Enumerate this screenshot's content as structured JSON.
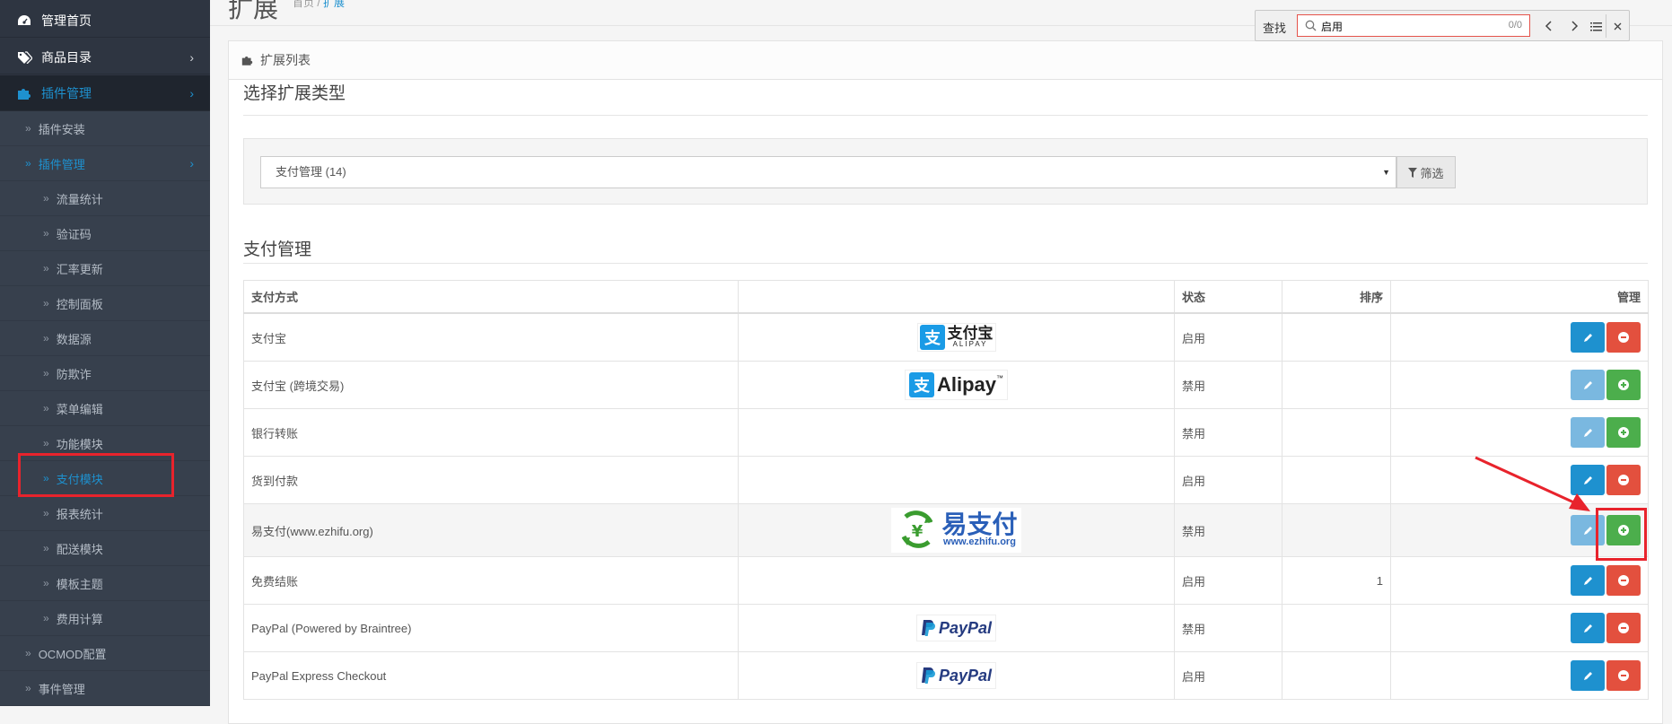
{
  "sidebar": {
    "items": [
      {
        "label": "管理首页",
        "icon": "dashboard-icon"
      },
      {
        "label": "商品目录",
        "icon": "tags-icon"
      },
      {
        "label": "插件管理",
        "icon": "puzzle-icon"
      }
    ],
    "sub_items": [
      {
        "label": "插件安装"
      },
      {
        "label": "插件管理"
      }
    ],
    "sub2_items": [
      {
        "label": "流量统计"
      },
      {
        "label": "验证码"
      },
      {
        "label": "汇率更新"
      },
      {
        "label": "控制面板"
      },
      {
        "label": "数据源"
      },
      {
        "label": "防欺诈"
      },
      {
        "label": "菜单编辑"
      },
      {
        "label": "功能模块"
      },
      {
        "label": "支付模块"
      },
      {
        "label": "报表统计"
      },
      {
        "label": "配送模块"
      },
      {
        "label": "模板主题"
      },
      {
        "label": "费用计算"
      }
    ],
    "bottom_items": [
      {
        "label": "OCMOD配置"
      },
      {
        "label": "事件管理"
      }
    ]
  },
  "header": {
    "title": "扩展",
    "breadcrumb_home": "首页",
    "breadcrumb_sep": " / ",
    "breadcrumb_current": "扩展"
  },
  "panel": {
    "heading": "扩展列表",
    "select_type_title": "选择扩展类型",
    "selected_type": "支付管理 (14)",
    "filter_label": "筛选",
    "section_title": "支付管理"
  },
  "table": {
    "headers": [
      "支付方式",
      "",
      "状态",
      "排序",
      "管理"
    ],
    "rows": [
      {
        "name": "支付宝",
        "logo": "alipay-cn",
        "status": "启用",
        "sort": "",
        "installed": true
      },
      {
        "name": "支付宝 (跨境交易)",
        "logo": "alipay-en",
        "status": "禁用",
        "sort": "",
        "installed": false
      },
      {
        "name": "银行转账",
        "logo": "",
        "status": "禁用",
        "sort": "",
        "installed": false
      },
      {
        "name": "货到付款",
        "logo": "",
        "status": "启用",
        "sort": "",
        "installed": true
      },
      {
        "name": "易支付(www.ezhifu.org)",
        "logo": "ezhifu",
        "status": "禁用",
        "sort": "",
        "installed": false
      },
      {
        "name": "免费结账",
        "logo": "",
        "status": "启用",
        "sort": "1",
        "installed": true
      },
      {
        "name": "PayPal (Powered by Braintree)",
        "logo": "paypal",
        "status": "禁用",
        "sort": "",
        "installed": true
      },
      {
        "name": "PayPal Express Checkout",
        "logo": "paypal",
        "status": "启用",
        "sort": "",
        "installed": true
      }
    ]
  },
  "logos": {
    "alipay_cn_text": "支付宝",
    "alipay_cn_sub": "ALIPAY",
    "alipay_en_text": "Alipay",
    "alipay_en_tm": "™",
    "ezhifu_text": "易支付",
    "ezhifu_url": "www.ezhifu.org",
    "paypal_text": "PayPal"
  },
  "find_bar": {
    "label": "查找",
    "query": "启用",
    "count": "0/0"
  },
  "colors": {
    "sidebar_bg": "#2e3541",
    "accent": "#1e91cf",
    "danger": "#e3503e",
    "success": "#4cae4c",
    "annotation_red": "#e8232c"
  }
}
